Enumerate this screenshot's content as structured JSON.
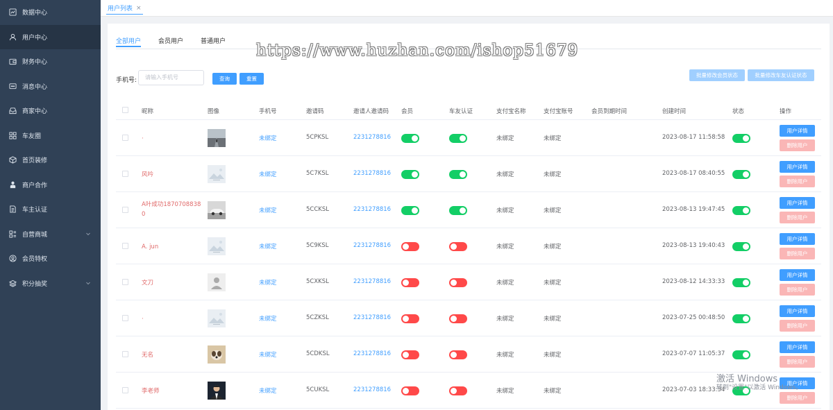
{
  "sidebar": {
    "items": [
      {
        "label": "数据中心",
        "icon": "chart-icon",
        "active": false
      },
      {
        "label": "用户中心",
        "icon": "user-icon",
        "active": true
      },
      {
        "label": "财务中心",
        "icon": "wallet-icon",
        "active": false
      },
      {
        "label": "消息中心",
        "icon": "message-icon",
        "active": false
      },
      {
        "label": "商家中心",
        "icon": "inbox-icon",
        "active": false
      },
      {
        "label": "车友圈",
        "icon": "grid-icon",
        "active": false
      },
      {
        "label": "首页装修",
        "icon": "box-icon",
        "active": false
      },
      {
        "label": "商户合作",
        "icon": "person-icon",
        "active": false
      },
      {
        "label": "车主认证",
        "icon": "document-icon",
        "active": false
      },
      {
        "label": "自营商城",
        "icon": "apps-icon",
        "active": false,
        "has_children": true
      },
      {
        "label": "会员特权",
        "icon": "user-circle-icon",
        "active": false
      },
      {
        "label": "积分抽奖",
        "icon": "layers-icon",
        "active": false,
        "has_children": true
      }
    ]
  },
  "tabs_view": {
    "active_tab": "用户列表",
    "close_glyph": "×"
  },
  "watermark": "https://www.huzhan.com/ishop51679",
  "subtabs": [
    "全部用户",
    "会员用户",
    "普通用户"
  ],
  "filter": {
    "label": "手机号:",
    "placeholder": "请输入手机号",
    "search_label": "查询",
    "reset_label": "重置",
    "batch_member_label": "批量修改会员状态",
    "batch_auth_label": "批量修改车友认证状态"
  },
  "table": {
    "headers": [
      "昵称",
      "图像",
      "手机号",
      "邀请码",
      "邀请人邀请码",
      "会员",
      "车友认证",
      "支付宝名称",
      "支付宝账号",
      "会员到期时间",
      "创建时间",
      "状态",
      "操作"
    ],
    "detail_label": "用户详情",
    "delete_label": "删除用户",
    "rows": [
      {
        "nickname": "·",
        "avatar": "road-photo",
        "phone": "未绑定",
        "invite_code": "5CPKSL",
        "inviter_code": "2231278816",
        "member": true,
        "auth": true,
        "alipay_name": "未绑定",
        "alipay_account": "未绑定",
        "expire": "",
        "created": "2023-08-17 11:58:58",
        "status": true
      },
      {
        "nickname": "风吟",
        "avatar": "placeholder-image",
        "phone": "未绑定",
        "invite_code": "5C7KSL",
        "inviter_code": "2231278816",
        "member": true,
        "auth": true,
        "alipay_name": "未绑定",
        "alipay_account": "未绑定",
        "expire": "",
        "created": "2023-08-17 08:40:55",
        "status": true
      },
      {
        "nickname": "A叶成功18707088380",
        "avatar": "car-photo",
        "phone": "未绑定",
        "invite_code": "5CCKSL",
        "inviter_code": "2231278816",
        "member": true,
        "auth": true,
        "alipay_name": "未绑定",
        "alipay_account": "未绑定",
        "expire": "",
        "created": "2023-08-13 19:47:45",
        "status": true
      },
      {
        "nickname": "A. jun",
        "avatar": "placeholder-image",
        "phone": "未绑定",
        "invite_code": "5C9KSL",
        "inviter_code": "2231278816",
        "member": false,
        "auth": false,
        "alipay_name": "未绑定",
        "alipay_account": "未绑定",
        "expire": "",
        "created": "2023-08-13 19:40:43",
        "status": true
      },
      {
        "nickname": "文刀",
        "avatar": "default-person",
        "phone": "未绑定",
        "invite_code": "5CXKSL",
        "inviter_code": "2231278816",
        "member": false,
        "auth": false,
        "alipay_name": "未绑定",
        "alipay_account": "未绑定",
        "expire": "",
        "created": "2023-08-12 14:33:33",
        "status": true
      },
      {
        "nickname": "·",
        "avatar": "placeholder-image",
        "phone": "未绑定",
        "invite_code": "5CZKSL",
        "inviter_code": "2231278816",
        "member": false,
        "auth": false,
        "alipay_name": "未绑定",
        "alipay_account": "未绑定",
        "expire": "",
        "created": "2023-07-25 00:48:50",
        "status": true
      },
      {
        "nickname": "无名",
        "avatar": "dog-photo",
        "phone": "未绑定",
        "invite_code": "5CDKSL",
        "inviter_code": "2231278816",
        "member": false,
        "auth": false,
        "alipay_name": "未绑定",
        "alipay_account": "未绑定",
        "expire": "",
        "created": "2023-07-07 11:05:37",
        "status": true
      },
      {
        "nickname": "李老师",
        "avatar": "man-photo",
        "phone": "未绑定",
        "invite_code": "5CUKSL",
        "inviter_code": "2231278816",
        "member": false,
        "auth": false,
        "alipay_name": "未绑定",
        "alipay_account": "未绑定",
        "expire": "",
        "created": "2023-07-03 18:33:34",
        "status": true
      }
    ]
  },
  "os_watermark": {
    "line1": "激活 Windows",
    "line2": "转到\"设置\"以激活 Windows。"
  },
  "colors": {
    "sidebar_bg": "#304156",
    "sidebar_active": "#263445",
    "primary": "#409eff",
    "switch_on": "#13ce66",
    "switch_off": "#ff4949",
    "nickname": "#e06a6a"
  }
}
